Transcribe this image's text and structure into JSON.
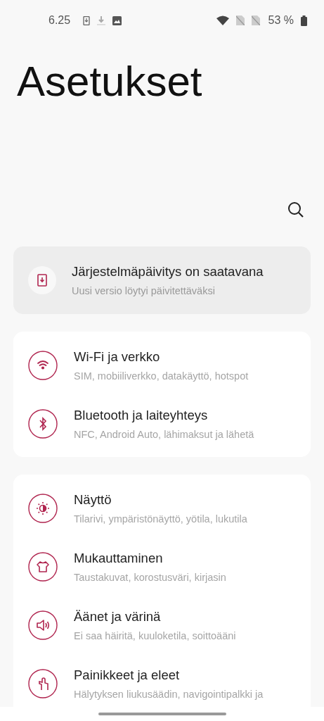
{
  "status_bar": {
    "time": "6.25",
    "battery": "53 %"
  },
  "title": "Asetukset",
  "update_card": {
    "title": "Järjestelmäpäivitys on saatavana",
    "subtitle": "Uusi versio löytyi päivitettäväksi"
  },
  "groups": [
    {
      "items": [
        {
          "kind": "wifi",
          "title": "Wi-Fi ja verkko",
          "subtitle": "SIM, mobiiliverkko, datakäyttö, hotspot"
        },
        {
          "kind": "bluetooth",
          "title": "Bluetooth ja laiteyhteys",
          "subtitle": "NFC, Android Auto, lähimaksut ja lähetä"
        }
      ]
    },
    {
      "items": [
        {
          "kind": "display",
          "title": "Näyttö",
          "subtitle": "Tilarivi, ympäristönäyttö, yötila, lukutila"
        },
        {
          "kind": "personalize",
          "title": "Mukauttaminen",
          "subtitle": "Taustakuvat, korostusväri, kirjasin"
        },
        {
          "kind": "sound",
          "title": "Äänet ja värinä",
          "subtitle": "Ei saa häiritä, kuuloketila, soittoääni"
        },
        {
          "kind": "gesture",
          "title": "Painikkeet ja eleet",
          "subtitle": "Hälytyksen liukusäädin, navigointipalkki ja"
        }
      ]
    }
  ]
}
